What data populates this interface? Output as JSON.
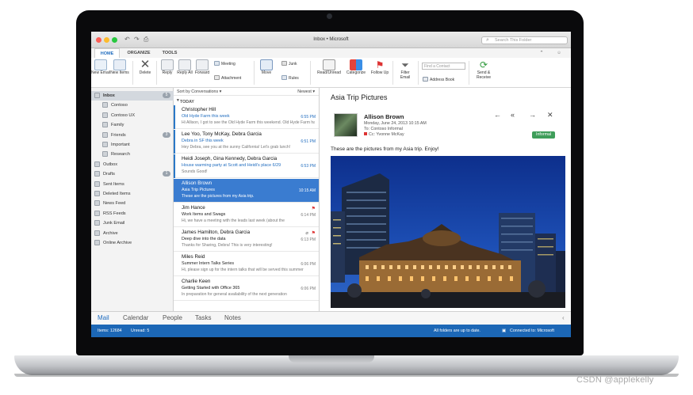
{
  "window": {
    "title": "Inbox • Microsoft",
    "search_placeholder": "Search This Folder"
  },
  "ribbon_tabs": [
    "HOME",
    "ORGANIZE",
    "TOOLS"
  ],
  "ribbon": {
    "new_email": "New Email",
    "new_items": "New Items",
    "delete": "Delete",
    "reply": "Reply",
    "reply_all": "Reply All",
    "forward": "Forward",
    "meeting": "Meeting",
    "attachment": "Attachment",
    "move": "Move",
    "junk": "Junk",
    "rules": "Rules",
    "read_unread": "Read/Unread",
    "categorize": "Categorize",
    "follow_up": "Follow Up",
    "filter_email": "Filter Email",
    "find_contact": "Find a Contact",
    "address_book": "Address Book",
    "send_receive": "Send & Receive"
  },
  "folders": [
    {
      "label": "Inbox",
      "count": "5"
    },
    {
      "label": "Contoso",
      "count": ""
    },
    {
      "label": "Contoso UX",
      "count": ""
    },
    {
      "label": "Family",
      "count": ""
    },
    {
      "label": "Friends",
      "count": "3"
    },
    {
      "label": "Important",
      "count": ""
    },
    {
      "label": "Research",
      "count": ""
    },
    {
      "label": "Outbox",
      "count": ""
    },
    {
      "label": "Drafts",
      "count": "1"
    },
    {
      "label": "Sent Items",
      "count": ""
    },
    {
      "label": "Deleted Items",
      "count": ""
    },
    {
      "label": "News Feed",
      "count": ""
    },
    {
      "label": "RSS Feeds",
      "count": ""
    },
    {
      "label": "Junk Email",
      "count": ""
    },
    {
      "label": "Archive",
      "count": ""
    },
    {
      "label": "Online Archive",
      "count": ""
    }
  ],
  "message_list": {
    "sort_label": "Sort by Conversations",
    "order_label": "Newest",
    "group": "TODAY",
    "messages": [
      {
        "from": "Christopher Hill",
        "subject": "Old Hyde Farm this week",
        "preview": "Hi Allison, I got to see the Old Hyde Farm this weekend. Old Hyde Farm has",
        "time": "6:55 PM",
        "unread": true
      },
      {
        "from": "Lee Yoo, Tony McKay, Debra Garcia",
        "subject": "Debra in SF this week",
        "preview": "Hey Debra, see you at the sunny California! Let's grab lunch!",
        "time": "6:51 PM",
        "unread": true
      },
      {
        "from": "Heidi Joseph, Gina Kennedy, Debra Garcia",
        "subject": "House warming party at Scott and Heidi's place 6/29",
        "preview": "Sounds Good!",
        "time": "6:53 PM",
        "unread": true
      },
      {
        "from": "Allison Brown",
        "subject": "Asia Trip Pictures",
        "preview": "These are the pictures from my Asia trip.",
        "time": "10:15 AM",
        "unread": false
      },
      {
        "from": "Jim Hance",
        "subject": "Work Items and Swags",
        "preview": "Hi, we have a meeting with the leads last week (about the",
        "time": "6:14 PM",
        "unread": false
      },
      {
        "from": "James Hamilton, Debra Garcia",
        "subject": "Deep dive into the data",
        "preview": "Thanks for Sharing, Debra! This is very interesting!",
        "time": "6:13 PM",
        "unread": false
      },
      {
        "from": "Miles Reid",
        "subject": "Summer Intern Talks Series",
        "preview": "Hi, please sign up for the intern talks that will be served this summer",
        "time": "6:06 PM",
        "unread": false
      },
      {
        "from": "Charlie Keen",
        "subject": "Getting Started with Office 365",
        "preview": "In preparation for general availability of the next generation",
        "time": "6:06 PM",
        "unread": false
      }
    ]
  },
  "reading": {
    "title": "Asia Trip Pictures",
    "sender": "Allison Brown",
    "date": "Monday, June 24, 2013 10:15 AM",
    "to": "To: Contoso Informal",
    "cc": "Cc: Yvonne McKay",
    "category": "Informal",
    "body": "These are the pictures from my Asia trip.   Enjoy!"
  },
  "nav": [
    "Mail",
    "Calendar",
    "People",
    "Tasks",
    "Notes"
  ],
  "status": {
    "items": "Items: 12684",
    "unread": "Unread: 5",
    "sync": "All folders are up to date.",
    "connected": "Connected to: Microsoft"
  },
  "watermark": "CSDN @applekelly",
  "colors": {
    "accent": "#1f6cbf",
    "status_bar": "#1c67b6",
    "selection": "#3a7cd0",
    "badge": "#3f9e5a"
  }
}
